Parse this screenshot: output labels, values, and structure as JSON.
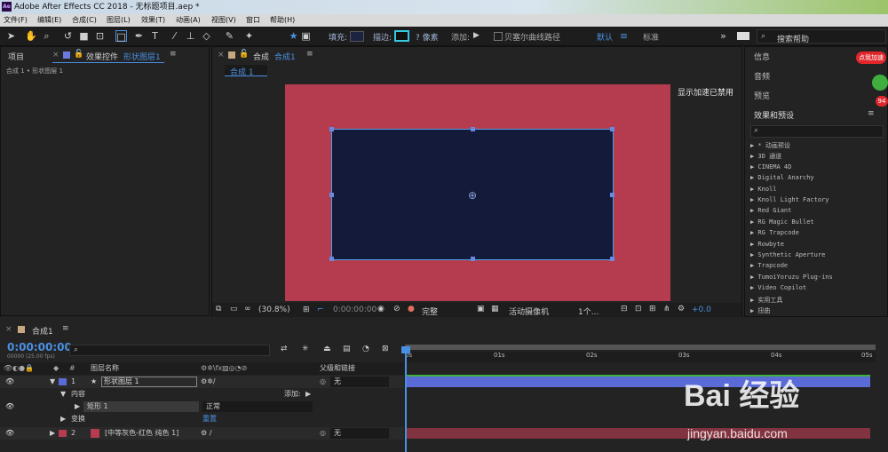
{
  "app": {
    "title": "Adobe After Effects CC 2018 - 无标题项目.aep *",
    "logo": "Ae"
  },
  "menu": [
    "文件(F)",
    "编辑(E)",
    "合成(C)",
    "图层(L)",
    "效果(T)",
    "动画(A)",
    "视图(V)",
    "窗口",
    "帮助(H)"
  ],
  "toolbar": {
    "fill_label": "填充:",
    "stroke_label": "描边:",
    "stroke_px": "? 像素",
    "add_label": "添加:",
    "bezier_label": "贝塞尔曲线路径",
    "workspace_default": "默认",
    "workspace_standard": "标准",
    "search_placeholder": "搜索帮助",
    "fill_color": "#1a2340",
    "stroke_color": "#33c9e0"
  },
  "left_panel": {
    "tab_project": "项目",
    "tab_effects_prefix": "效果控件",
    "tab_effects_layer": "形状图层1",
    "breadcrumb": "合成 1 • 形状图层 1"
  },
  "viewer": {
    "tab_label": "合成",
    "tab_comp": "合成1",
    "comp_subtab": "合成 1",
    "gpu_notice": "显示加速已禁用",
    "bg_color": "#b43c4e",
    "shape_color": "#141a3a",
    "zoom": "(30.8%)",
    "timecode": "0:00:00:00",
    "quality": "完整",
    "camera": "活动摄像机",
    "views": "1个...",
    "exposure": "+0.0"
  },
  "right_panel": {
    "info": "信息",
    "audio": "音频",
    "preview": "预览",
    "effects_presets": "效果和预设",
    "search_placeholder": "",
    "items": [
      "* 动画预设",
      "3D 通道",
      "CINEMA 4D",
      "Digital Anarchy",
      "Knoll",
      "Knoll Light Factory",
      "Red Giant",
      "RG Magic Bullet",
      "RG Trapcode",
      "Rowbyte",
      "Synthetic Aperture",
      "Trapcode",
      "TumoiYoruzu Plug-ins",
      "Video Copilot",
      "实用工具",
      "扭曲"
    ]
  },
  "timeline": {
    "tab": "合成1",
    "timecode": "0:00:00:00",
    "fps": "00000 (25.00 fps)",
    "col_layer_name": "图层名称",
    "col_parent": "父级和链接",
    "layer1": {
      "num": "1",
      "name": "形状图层 1",
      "parent": "无"
    },
    "contents": "内容",
    "add": "添加:",
    "rect": "矩形 1",
    "mode": "正常",
    "transform": "变换",
    "reset": "重置",
    "layer2": {
      "num": "2",
      "name": "[中等灰色-红色 纯色 1]",
      "parent": "无"
    },
    "ticks": [
      "0s",
      "01s",
      "02s",
      "03s",
      "04s",
      "05s"
    ],
    "layer1_color": "#5a6bd8",
    "layer2_color": "#b43c4e"
  },
  "watermark": {
    "text": "Bai 经验",
    "url": "jingyan.baidu.com"
  },
  "badge": {
    "text": "点我加速",
    "num": "94"
  }
}
